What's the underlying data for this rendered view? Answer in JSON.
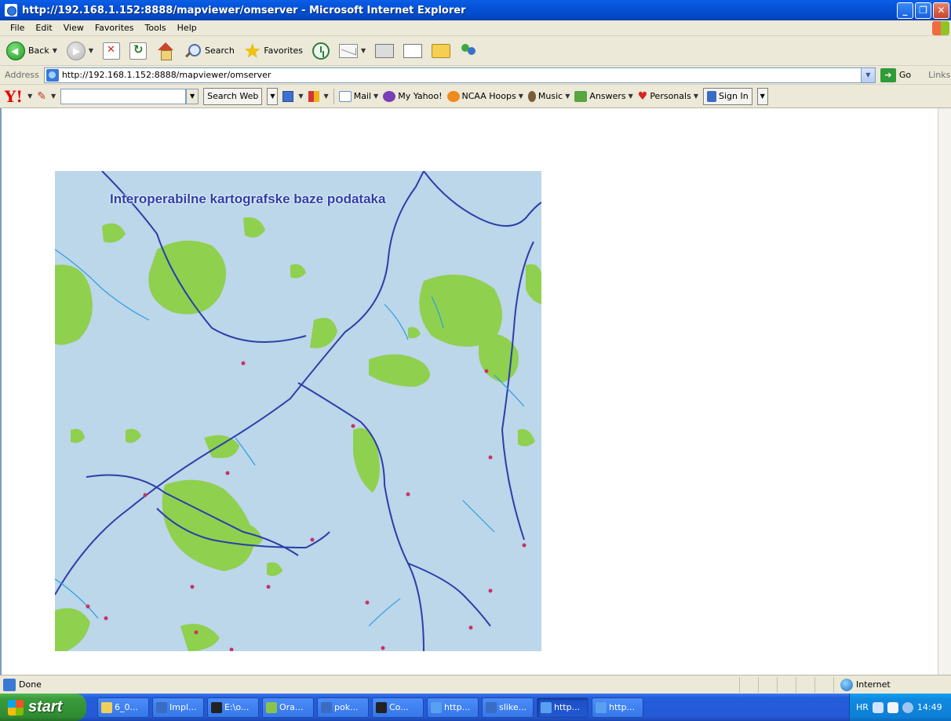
{
  "window": {
    "title": "http://192.168.1.152:8888/mapviewer/omserver - Microsoft Internet Explorer",
    "min_glyph": "_",
    "max_glyph": "❐",
    "close_glyph": "✕"
  },
  "menu": [
    "File",
    "Edit",
    "View",
    "Favorites",
    "Tools",
    "Help"
  ],
  "toolbar": {
    "back_label": "Back",
    "search_label": "Search",
    "favorites_label": "Favorites"
  },
  "address": {
    "label": "Address",
    "url": "http://192.168.1.152:8888/mapviewer/omserver",
    "go_label": "Go",
    "links_label": "Links"
  },
  "yahoo": {
    "logo": "Y!",
    "search_button": "Search Web",
    "items": [
      "Mail",
      "My Yahoo!",
      "NCAA Hoops",
      "Music",
      "Answers",
      "Personals"
    ],
    "signin": "Sign In"
  },
  "map": {
    "title": "Interoperabilne kartografske baze podataka"
  },
  "status": {
    "text": "Done",
    "zone": "Internet"
  },
  "taskbar": {
    "start_label": "start",
    "tasks": [
      "6_0...",
      "Impl...",
      "E:\\o...",
      "Ora...",
      "pok...",
      "Co...",
      "http...",
      "slike...",
      "http...",
      "http..."
    ],
    "tray_lang": "HR",
    "clock": "14:49"
  },
  "colors": {
    "map_water": "#bcd6ea",
    "map_forest": "#8fd04f",
    "map_river": "#2b3fa8",
    "map_stream": "#2a9fe0",
    "map_marker": "#c8326a"
  }
}
